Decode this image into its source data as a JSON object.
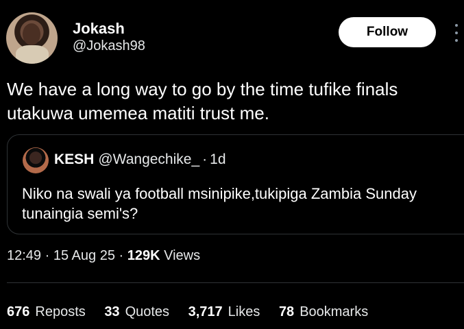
{
  "author": {
    "display_name": "Jokash",
    "handle": "@Jokash98"
  },
  "follow_label": "Follow",
  "tweet_text": "We have a long way to go by the time tufike finals utakuwa umemea matiti trust me.",
  "quoted": {
    "display_name": "KESH",
    "handle": "@Wangechike_",
    "separator": "·",
    "time": "1d",
    "text": "Niko na swali ya football msinipike,tukipiga Zambia Sunday tunaingia semi's?"
  },
  "meta": {
    "time": "12:49",
    "separator": "·",
    "date": "15 Aug 25",
    "views_count": "129K",
    "views_label": "Views"
  },
  "stats": [
    {
      "count": "676",
      "label": "Reposts"
    },
    {
      "count": "33",
      "label": "Quotes"
    },
    {
      "count": "3,717",
      "label": "Likes"
    },
    {
      "count": "78",
      "label": "Bookmarks"
    }
  ],
  "icons": {
    "more": "more-options-icon"
  }
}
